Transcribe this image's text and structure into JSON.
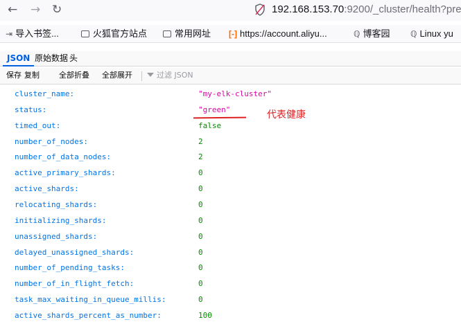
{
  "navigation": {
    "back_icon": "←",
    "forward_icon": "→",
    "reload_icon": "↻",
    "url_host": "192.168.153.70",
    "url_rest": ":9200/_cluster/health?pretty"
  },
  "bookmarks": [
    {
      "icon": "import-icon",
      "label": "导入书签..."
    },
    {
      "icon": "folder-icon",
      "label": "火狐官方站点"
    },
    {
      "icon": "folder-icon",
      "label": "常用网址"
    },
    {
      "icon": "aliyun-icon",
      "label": "https://account.aliyu..."
    },
    {
      "icon": "cnblogs-icon",
      "label": "博客园"
    },
    {
      "icon": "cnblogs-icon",
      "label": "Linux yu"
    }
  ],
  "tabs": {
    "json": "JSON",
    "raw": "原始数据",
    "headers": "头"
  },
  "toolbar": {
    "save": "保存",
    "copy": "复制",
    "collapse_all": "全部折叠",
    "expand_all": "全部展开",
    "filter_placeholder": "过滤 JSON"
  },
  "json_rows": [
    {
      "key": "cluster_name:",
      "value": "\"my-elk-cluster\"",
      "type": "string"
    },
    {
      "key": "status:",
      "value": "\"green\"",
      "type": "string"
    },
    {
      "key": "timed_out:",
      "value": "false",
      "type": "bool"
    },
    {
      "key": "number_of_nodes:",
      "value": "2",
      "type": "number"
    },
    {
      "key": "number_of_data_nodes:",
      "value": "2",
      "type": "number"
    },
    {
      "key": "active_primary_shards:",
      "value": "0",
      "type": "number"
    },
    {
      "key": "active_shards:",
      "value": "0",
      "type": "number"
    },
    {
      "key": "relocating_shards:",
      "value": "0",
      "type": "number"
    },
    {
      "key": "initializing_shards:",
      "value": "0",
      "type": "number"
    },
    {
      "key": "unassigned_shards:",
      "value": "0",
      "type": "number"
    },
    {
      "key": "delayed_unassigned_shards:",
      "value": "0",
      "type": "number"
    },
    {
      "key": "number_of_pending_tasks:",
      "value": "0",
      "type": "number"
    },
    {
      "key": "number_of_in_flight_fetch:",
      "value": "0",
      "type": "number"
    },
    {
      "key": "task_max_waiting_in_queue_millis:",
      "value": "0",
      "type": "number"
    },
    {
      "key": "active_shards_percent_as_number:",
      "value": "100",
      "type": "number"
    }
  ],
  "annotation": {
    "text": "代表健康",
    "color": "#e02020"
  },
  "colors": {
    "key": "#0074e8",
    "string": "#dd00a9",
    "number": "#058b00",
    "active_tab": "#0060df"
  }
}
